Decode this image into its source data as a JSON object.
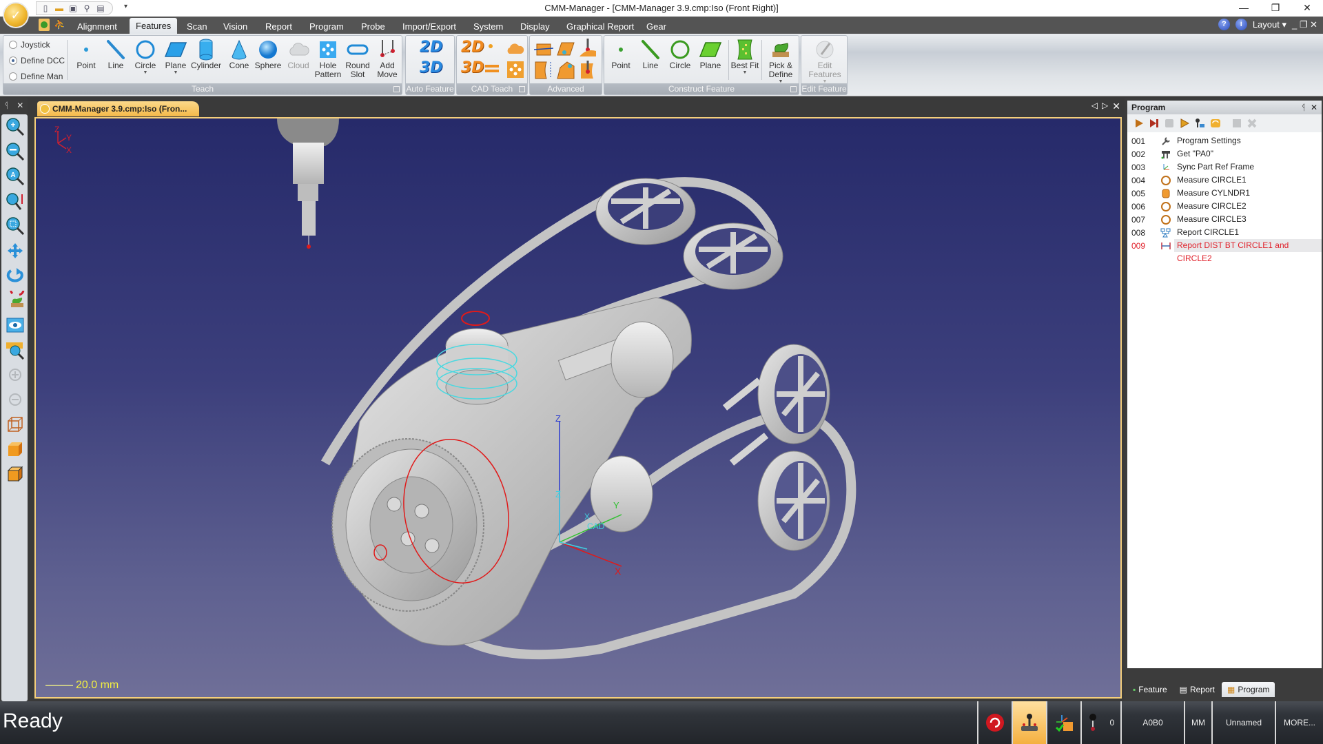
{
  "window": {
    "title": "CMM-Manager - [CMM-Manager 3.9.cmp:Iso (Front Right)]",
    "controls": {
      "minimize": "—",
      "restore": "❐",
      "close": "✕"
    }
  },
  "quick_access": [
    "new-file-icon",
    "open-folder-icon",
    "save-icon",
    "probe-icon",
    "report-icon"
  ],
  "menu": {
    "tabs": [
      "Alignment",
      "Features",
      "Scan",
      "Vision",
      "Report",
      "Program",
      "Probe",
      "Import/Export",
      "System",
      "Display",
      "Graphical Report",
      "Gear"
    ],
    "active_tab": "Features",
    "help_label": "?",
    "info_label": "i",
    "layout_label": "Layout ▾",
    "mdi_controls": "_ ❐ ✕"
  },
  "ribbon": {
    "teach": {
      "label": "Teach",
      "modes": [
        {
          "label": "Joystick",
          "selected": false
        },
        {
          "label": "Define DCC",
          "selected": true
        },
        {
          "label": "Define Man",
          "selected": false
        }
      ],
      "buttons": [
        {
          "label": "Point",
          "icon": "point-icon"
        },
        {
          "label": "Line",
          "icon": "line-icon"
        },
        {
          "label": "Circle",
          "icon": "circle-icon",
          "dropdown": true
        },
        {
          "label": "Plane",
          "icon": "plane-icon",
          "dropdown": true
        },
        {
          "label": "Cylinder",
          "icon": "cylinder-icon"
        },
        {
          "label": "Cone",
          "icon": "cone-icon"
        },
        {
          "label": "Sphere",
          "icon": "sphere-icon"
        },
        {
          "label": "Cloud",
          "icon": "cloud-icon",
          "disabled": true
        },
        {
          "label": "Hole Pattern",
          "icon": "hole-pattern-icon"
        },
        {
          "label": "Round Slot",
          "icon": "round-slot-icon",
          "dropdown": true
        },
        {
          "label": "Add Move",
          "icon": "add-move-icon"
        }
      ]
    },
    "auto_feature": {
      "label": "Auto Feature",
      "buttons": [
        "2D",
        "3D"
      ]
    },
    "cad_teach": {
      "label": "CAD Teach",
      "buttons": [
        "2D",
        "3D"
      ]
    },
    "advanced": {
      "label": "Advanced"
    },
    "construct": {
      "label": "Construct Feature",
      "buttons": [
        {
          "label": "Point"
        },
        {
          "label": "Line"
        },
        {
          "label": "Circle"
        },
        {
          "label": "Plane"
        },
        {
          "label": "Best Fit",
          "dropdown": true
        },
        {
          "label": "Pick & Define",
          "dropdown": true
        }
      ]
    },
    "edit_feature": {
      "label": "Edit Feature",
      "button": "Edit Features",
      "disabled": true
    }
  },
  "left_toolbar": {
    "header": {
      "pin": "ᛩ",
      "close": "✕"
    },
    "tools": [
      "zoom-in-icon",
      "zoom-out-icon",
      "zoom-all-icon",
      "zoom-vertical-icon",
      "zoom-window-icon",
      "pan-icon",
      "rotate-icon",
      "rotate-pick-icon",
      "view-eye-icon",
      "label-zoom-icon",
      "disabled-view-a-icon",
      "disabled-view-b-icon",
      "wireframe-cube-icon",
      "shaded-cube-icon",
      "shaded-edges-cube-icon"
    ]
  },
  "document": {
    "tab_label": "CMM-Manager 3.9.cmp:Iso (Fron...",
    "nav": {
      "prev": "◁",
      "next": "▷",
      "close": "✕"
    },
    "viewport": {
      "triad_labels": {
        "z": "Z",
        "y": "Y",
        "x": "X"
      },
      "cad_axes": {
        "z_upper": "Z",
        "z_lower": "Z",
        "y": "Y",
        "x": "X",
        "x_cyan": "X",
        "cad": "CAD"
      },
      "scale_label": "20.0 mm"
    }
  },
  "program_panel": {
    "title": "Program",
    "controls": {
      "pin": "ᛩ",
      "close": "✕"
    },
    "toolbar": [
      "run-icon",
      "run-to-end-icon",
      "stop-icon",
      "step-icon",
      "probe-settings-icon",
      "refresh-icon",
      "block-icon",
      "delete-icon"
    ],
    "rows": [
      {
        "num": "001",
        "icon": "wrench-icon",
        "text": "Program Settings"
      },
      {
        "num": "002",
        "icon": "probe-rack-icon",
        "text": "Get \"PA0\""
      },
      {
        "num": "003",
        "icon": "sync-frame-icon",
        "text": "Sync Part Ref Frame"
      },
      {
        "num": "004",
        "icon": "circle-feature-icon",
        "text": "Measure CIRCLE1"
      },
      {
        "num": "005",
        "icon": "cylinder-feature-icon",
        "text": "Measure CYLNDR1"
      },
      {
        "num": "006",
        "icon": "circle-feature-icon",
        "text": "Measure CIRCLE2"
      },
      {
        "num": "007",
        "icon": "circle-feature-icon",
        "text": "Measure CIRCLE3"
      },
      {
        "num": "008",
        "icon": "report-tree-icon",
        "text": "Report CIRCLE1"
      },
      {
        "num": "009",
        "icon": "distance-icon",
        "text": "Report DIST BT CIRCLE1 and CIRCLE2",
        "selected": true
      }
    ],
    "bottom_tabs": [
      {
        "label": "Feature",
        "active": false
      },
      {
        "label": "Report",
        "active": false
      },
      {
        "label": "Program",
        "active": true
      }
    ]
  },
  "status_bar": {
    "message": "Ready",
    "probe_count": "0",
    "probe_label": "A0B0",
    "units": "MM",
    "alignment": "Unnamed",
    "more": "MORE..."
  },
  "colors": {
    "accent_orange": "#f4b94a",
    "selected_row_text": "#e0202a",
    "viewport_top": "#262a6a",
    "viewport_bottom": "#6f6f98",
    "scale_text": "#f4f040"
  }
}
